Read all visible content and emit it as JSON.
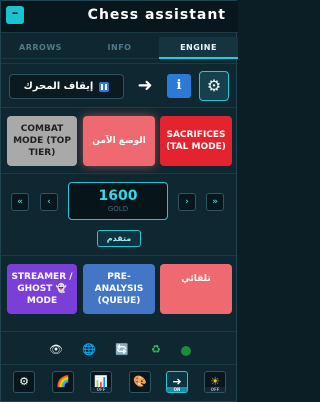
{
  "window": {
    "title": "Chess assistant",
    "minimize_label": "–"
  },
  "tabs": [
    {
      "label": "ARROWS",
      "active": false
    },
    {
      "label": "INFO",
      "active": false
    },
    {
      "label": "ENGINE",
      "active": true
    }
  ],
  "toolbar": {
    "stop_label": "إيقاف المحرك",
    "arrow_label": "➜",
    "info_label": "i",
    "gear_label": "⚙"
  },
  "modes_top": [
    {
      "label": "COMBAT MODE (TOP TIER)",
      "color": "#a9a9a9"
    },
    {
      "label": "الوضع الآمن",
      "color": "#ef6a70"
    },
    {
      "label": "SACRIFICES (TAL MODE)",
      "color": "#e3242f"
    }
  ],
  "elo": {
    "value": "1600",
    "rank": "GOLD",
    "prev_fast": "«",
    "prev": "‹",
    "next": "›",
    "next_fast": "»",
    "level_label": "متقدم"
  },
  "modes_bottom": [
    {
      "label": "STREAMER / GHOST 👻 MODE",
      "color": "#7b3fd9"
    },
    {
      "label": "PRE-ANALYSIS (QUEUE)",
      "color": "#4377c6"
    },
    {
      "label": "تلقائي",
      "color": "#ef6a70"
    }
  ],
  "status_icons": {
    "eye": "👁",
    "globe": "🌐",
    "refresh": "🔄",
    "recycle": "♻",
    "connection_color": "#1f8a3a"
  },
  "bottom_bar": [
    {
      "icon": "⚙",
      "state": ""
    },
    {
      "icon": "🌈",
      "state": ""
    },
    {
      "icon": "📊",
      "state": "OFF"
    },
    {
      "icon": "🎨",
      "state": ""
    },
    {
      "icon": "➜",
      "state": "ON"
    },
    {
      "icon": "☀",
      "state": "OFF"
    }
  ]
}
